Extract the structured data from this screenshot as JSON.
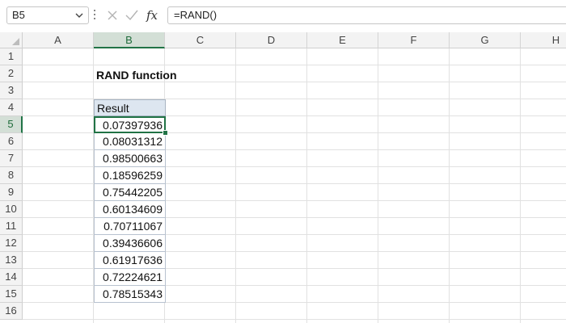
{
  "formula_bar": {
    "name_box": "B5",
    "fx_label": "fx",
    "formula": "=RAND()"
  },
  "columns": [
    "A",
    "B",
    "C",
    "D",
    "E",
    "F",
    "G",
    "H"
  ],
  "rows": [
    "1",
    "2",
    "3",
    "4",
    "5",
    "6",
    "7",
    "8",
    "9",
    "10",
    "11",
    "12",
    "13",
    "14",
    "15",
    "16"
  ],
  "selected_column": "B",
  "selected_row": "5",
  "sheet": {
    "title": "RAND function",
    "table_header": "Result",
    "values": [
      "0.07397936",
      "0.08031312",
      "0.98500663",
      "0.18596259",
      "0.75442205",
      "0.60134609",
      "0.70711067",
      "0.39436606",
      "0.61917636",
      "0.72224621",
      "0.78515343"
    ]
  },
  "colors": {
    "accent": "#217346",
    "header_bg": "#f3f3f3",
    "table_header_bg": "#dde6f0"
  }
}
